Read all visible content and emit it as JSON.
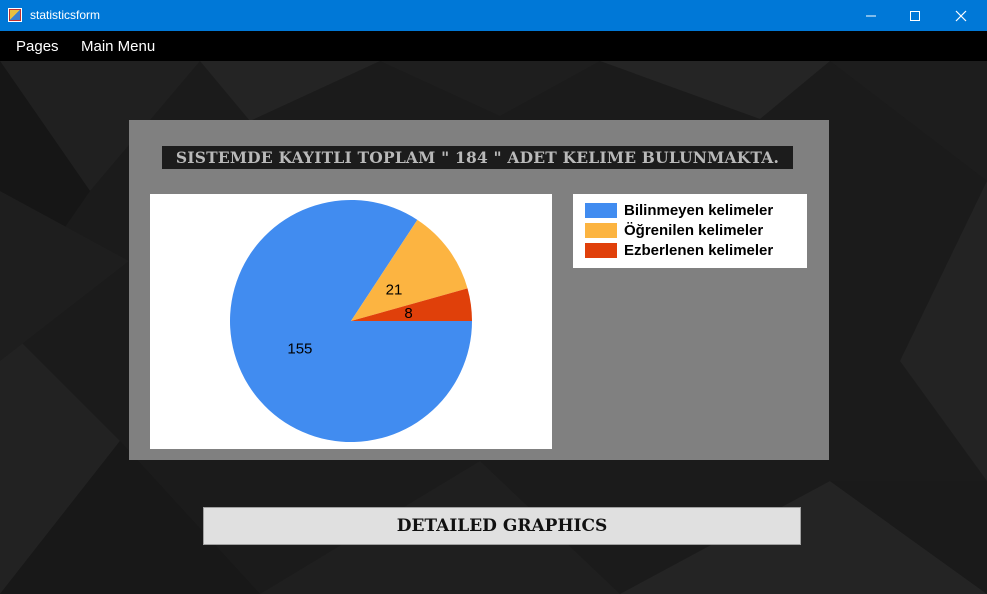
{
  "window": {
    "title": "statisticsform",
    "minimize_icon": "minimize-icon",
    "maximize_icon": "maximize-icon",
    "close_icon": "close-icon"
  },
  "menu": {
    "pages_label": "Pages",
    "main_menu_label": "Main Menu"
  },
  "panel": {
    "headline": "SISTEMDE KAYITLI TOPLAM \" 184 \" ADET KELIME BULUNMAKTA."
  },
  "chart_data": {
    "type": "pie",
    "categories": [
      "Bilinmeyen kelimeler",
      "Öğrenilen kelimeler",
      "Ezberlenen kelimeler"
    ],
    "values": [
      155,
      21,
      8
    ],
    "data_labels": [
      "155",
      "21",
      "8"
    ],
    "colors": [
      "#418cf0",
      "#fcb441",
      "#e0400a"
    ],
    "legend": "right",
    "title": ""
  },
  "buttons": {
    "detailed_graphics": "DETAILED GRAPHICS"
  }
}
